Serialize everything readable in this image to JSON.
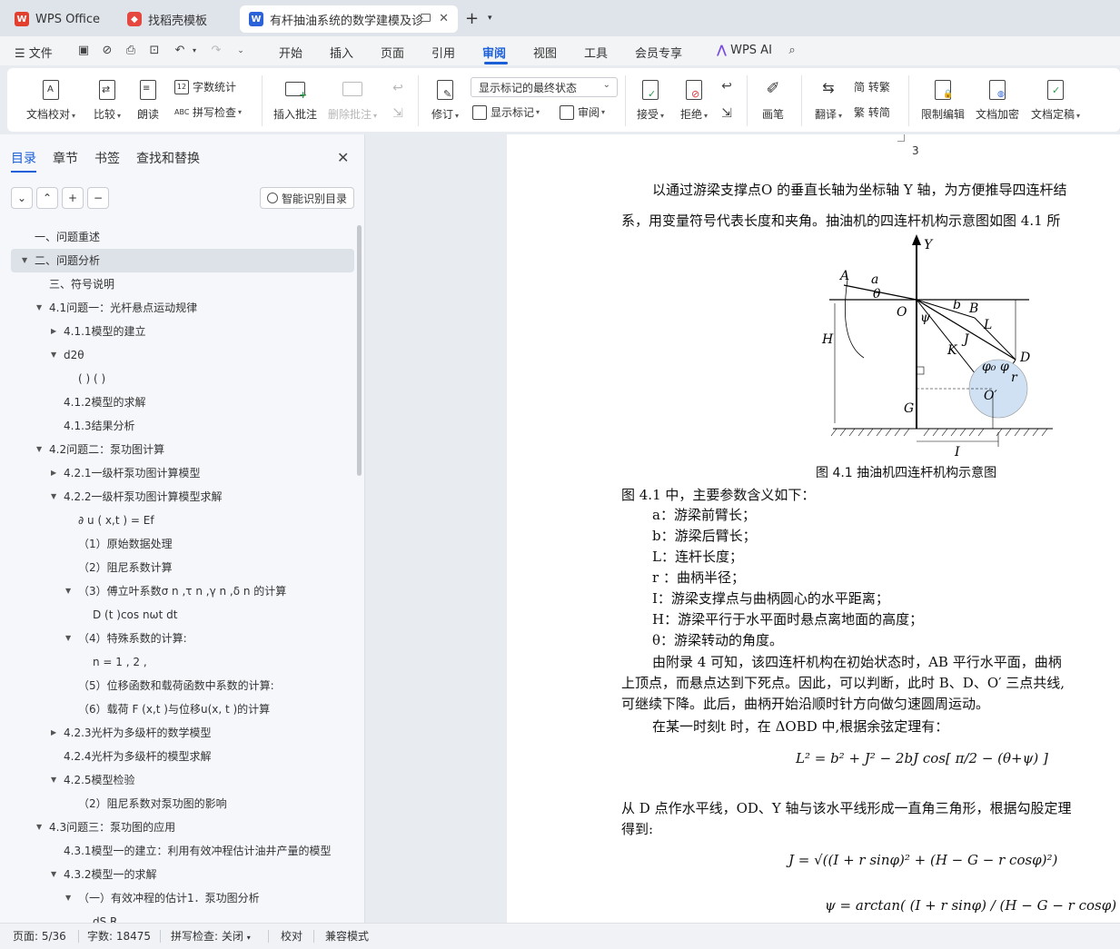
{
  "tabs": {
    "t1": {
      "label": "WPS Office",
      "icon": "wps-logo-icon"
    },
    "t2": {
      "label": "找稻壳模板",
      "icon": "docer-logo-icon"
    },
    "t3": {
      "label": "有杆抽油系统的数学建模及诊断",
      "icon": "word-doc-icon"
    }
  },
  "menu": {
    "file": "文件",
    "items": [
      "开始",
      "插入",
      "页面",
      "引用",
      "审阅",
      "视图",
      "工具",
      "会员专享"
    ],
    "active": "审阅",
    "ai": "WPS AI"
  },
  "ribbon": {
    "proofread": "文档校对",
    "compare": "比较",
    "read_aloud": "朗读",
    "word_count": "字数统计",
    "spell_check": "拼写检查",
    "insert_comment": "插入批注",
    "delete_comment": "删除批注",
    "revise": "修订",
    "markup_combo": "显示标记的最终状态",
    "show_markup": "显示标记",
    "review": "审阅",
    "accept": "接受",
    "reject": "拒绝",
    "pen": "画笔",
    "translate": "翻译",
    "trad": "简 转繁",
    "simp": "繁 转简",
    "restrict": "限制编辑",
    "encrypt": "文档加密",
    "finalize": "文档定稿"
  },
  "leftpanel": {
    "tabs": [
      "目录",
      "章节",
      "书签",
      "查找和替换"
    ],
    "smart_toc": "智能识别目录",
    "toc": [
      {
        "text": "一、问题重述",
        "level": 0,
        "arrow": ""
      },
      {
        "text": "二、问题分析",
        "level": 0,
        "arrow": "down",
        "selected": true
      },
      {
        "text": "三、符号说明",
        "level": 1,
        "arrow": ""
      },
      {
        "text": "4.1问题一：光杆悬点运动规律",
        "level": 1,
        "arrow": "down"
      },
      {
        "text": "4.1.1模型的建立",
        "level": 2,
        "arrow": "right"
      },
      {
        "text": "d2θ",
        "level": 2,
        "arrow": "down"
      },
      {
        "text": "( ) ( )",
        "level": 3,
        "arrow": ""
      },
      {
        "text": "4.1.2模型的求解",
        "level": 2,
        "arrow": ""
      },
      {
        "text": "4.1.3结果分析",
        "level": 2,
        "arrow": ""
      },
      {
        "text": "4.2问题二：泵功图计算",
        "level": 1,
        "arrow": "down"
      },
      {
        "text": "4.2.1一级杆泵功图计算模型",
        "level": 2,
        "arrow": "right"
      },
      {
        "text": "4.2.2一级杆泵功图计算模型求解",
        "level": 2,
        "arrow": "down"
      },
      {
        "text": "∂ u ( x,t ) = Ef",
        "level": 3,
        "arrow": ""
      },
      {
        "text": "（1）原始数据处理",
        "level": 3,
        "arrow": ""
      },
      {
        "text": "（2）阻尼系数计算",
        "level": 3,
        "arrow": ""
      },
      {
        "text": "（3）傅立叶系数σ n ,τ n ,γ n ,δ n 的计算",
        "level": 3,
        "arrow": "down"
      },
      {
        "text": "D (t )cos nωt dt",
        "level": 4,
        "arrow": ""
      },
      {
        "text": "（4）特殊系数的计算:",
        "level": 3,
        "arrow": "down"
      },
      {
        "text": "n = 1 , 2 ,",
        "level": 4,
        "arrow": ""
      },
      {
        "text": "（5）位移函数和载荷函数中系数的计算:",
        "level": 3,
        "arrow": ""
      },
      {
        "text": "（6）载荷 F (x,t )与位移u(x, t )的计算",
        "level": 3,
        "arrow": ""
      },
      {
        "text": "4.2.3光杆为多级杆的数学模型",
        "level": 2,
        "arrow": "right"
      },
      {
        "text": "4.2.4光杆为多级杆的模型求解",
        "level": 2,
        "arrow": ""
      },
      {
        "text": "4.2.5模型检验",
        "level": 2,
        "arrow": "down"
      },
      {
        "text": "（2）阻尼系数对泵功图的影响",
        "level": 3,
        "arrow": ""
      },
      {
        "text": "4.3问题三：泵功图的应用",
        "level": 1,
        "arrow": "down"
      },
      {
        "text": "4.3.1模型一的建立：利用有效冲程估计油井产量的模型",
        "level": 2,
        "arrow": ""
      },
      {
        "text": "4.3.2模型一的求解",
        "level": 2,
        "arrow": "down"
      },
      {
        "text": "（一）有效冲程的估计1．泵功图分析",
        "level": 3,
        "arrow": "down"
      },
      {
        "text": "dS R",
        "level": 4,
        "arrow": ""
      }
    ]
  },
  "doc": {
    "page_number": "3",
    "para1_l1": "以通过游梁支撑点O 的垂直长轴为坐标轴  Y  轴，为方便推导四连杆结",
    "para1_l2": "系，用变量符号代表长度和夹角。抽油机的四连杆机构示意图如图  4.1 所",
    "caption": "图 4.1 抽油机四连杆机构示意图",
    "intro": "图  4.1 中，主要参数含义如下：",
    "params": [
      "a：游梁前臂长；",
      "b：游梁后臂长；",
      "L：连杆长度；",
      "r ：曲柄半径；",
      "I：游梁支撑点与曲柄圆心的水平距离；",
      "H：游梁平行于水平面时悬点离地面的高度；",
      "θ：游梁转动的角度。"
    ],
    "para2_l1": "由附录 4 可知，该四连杆机构在初始状态时，AB 平行水平面，曲柄",
    "para2_l2": "上顶点，而悬点达到下死点。因此，可以判断，此时 B、D、O′ 三点共线,",
    "para2_l3": "可继续下降。此后，曲柄开始沿顺时针方向做匀速圆周运动。",
    "para3": "在某一时刻t 时，在  ΔOBD 中,根据余弦定理有：",
    "formula1": "L² = b² + J² − 2bJ cos[ π/2 − (θ+ψ) ]",
    "para4_l1": "从 D 点作水平线，OD、Y 轴与该水平线形成一直角三角形，根据勾股定理",
    "para4_l2": "得到:",
    "formula2": "J = √((I + r sinφ)² + (H − G − r cosφ)²)",
    "formula3": "ψ = arctan( (I + r sinφ) / (H − G − r cosφ) )",
    "fig_labels": {
      "A": "A",
      "a": "a",
      "theta": "θ",
      "O": "O",
      "psi": "ψ",
      "b": "b",
      "B": "B",
      "L": "L",
      "J": "J",
      "K": "K",
      "D": "D",
      "phi0": "φ₀",
      "phi": "φ",
      "r": "r",
      "O2": "O′",
      "H": "H",
      "G": "G",
      "I": "I",
      "Y": "Y"
    }
  },
  "status": {
    "page": "页面: 5/36",
    "words": "字数: 18475",
    "spell": "拼写检查: 关闭",
    "proof": "校对",
    "compat": "兼容模式"
  },
  "colors": {
    "accent": "#1a5fd8",
    "wps_red": "#e23f2f",
    "word_blue": "#2b62d9"
  }
}
